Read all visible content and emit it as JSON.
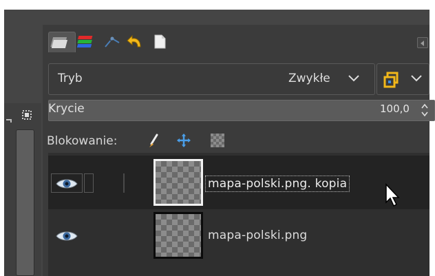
{
  "tabs": [
    {
      "icon": "layers-icon",
      "active": true
    },
    {
      "icon": "channels-icon",
      "active": false
    },
    {
      "icon": "paths-icon",
      "active": false
    },
    {
      "icon": "undo-history-icon",
      "active": false
    },
    {
      "icon": "document-icon",
      "active": false
    }
  ],
  "mode": {
    "label": "Tryb",
    "value": "Zwykłe"
  },
  "opacity": {
    "label": "Krycie",
    "value": "100,0"
  },
  "lock": {
    "label": "Blokowanie:"
  },
  "layers": [
    {
      "name": "mapa-polski.png. kopia",
      "visible": true,
      "selected": true
    },
    {
      "name": "mapa-polski.png",
      "visible": true,
      "selected": false
    }
  ],
  "colors": {
    "background": "#3b3b3b",
    "selected_row": "#232323",
    "accent_blue": "#4a9ee8"
  }
}
